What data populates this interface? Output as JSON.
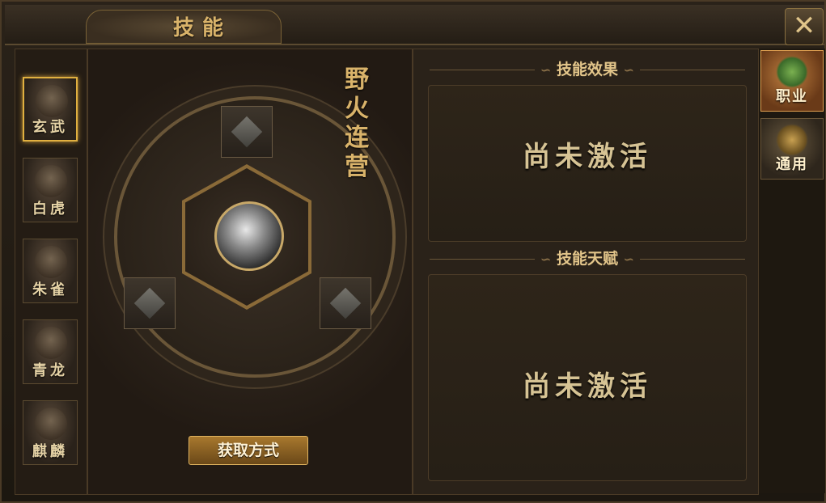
{
  "window": {
    "title": "技能",
    "close_symbol": "✕"
  },
  "beasts": [
    {
      "label": "玄武",
      "active": true
    },
    {
      "label": "白虎",
      "active": false
    },
    {
      "label": "朱雀",
      "active": false
    },
    {
      "label": "青龙",
      "active": false
    },
    {
      "label": "麒麟",
      "active": false
    }
  ],
  "skill": {
    "name_chars": [
      "野",
      "火",
      "连",
      "营"
    ],
    "obtain_button": "获取方式"
  },
  "effect": {
    "heading": "技能效果",
    "status": "尚未激活"
  },
  "talent": {
    "heading": "技能天赋",
    "status": "尚未激活"
  },
  "side_tabs": [
    {
      "label": "职业",
      "active": true
    },
    {
      "label": "通用",
      "active": false
    }
  ]
}
